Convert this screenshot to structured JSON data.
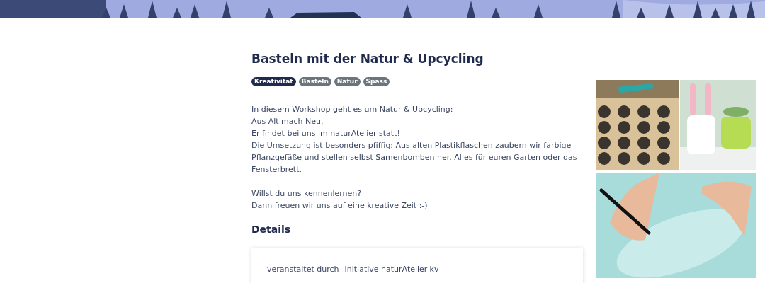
{
  "banner": {
    "kind": "picture"
  },
  "title": "Basteln mit der Natur & Upcycling",
  "tags": [
    {
      "label": "Kreativität",
      "color": "#1f2a4d"
    },
    {
      "label": "Basteln",
      "color": "#6c757d"
    },
    {
      "label": "Natur",
      "color": "#6c757d"
    },
    {
      "label": "Spass",
      "color": "#6c757d"
    }
  ],
  "description": [
    [
      "In diesem Workshop geht es um Natur & Upcycling:",
      "Aus Alt mach Neu.",
      "Er findet bei uns im naturAtelier statt!",
      "Die Umsetzung ist besonders pfiffig: Aus alten Plastikflaschen zaubern wir farbige Pflanzgefäße und stellen selbst Samenbomben her. Alles für euren Garten oder das Fensterbrett."
    ],
    [
      "Willst du uns kennenlernen?",
      "Dann freuen wir uns auf eine kreative Zeit :-)"
    ]
  ],
  "details": {
    "heading": "Details",
    "rows": [
      {
        "label": "veranstaltet durch",
        "value": "Initiative naturAtelier-kv"
      }
    ]
  },
  "photos": [
    {
      "kind": "picture"
    },
    {
      "kind": "picture"
    },
    {
      "kind": "picture"
    }
  ]
}
